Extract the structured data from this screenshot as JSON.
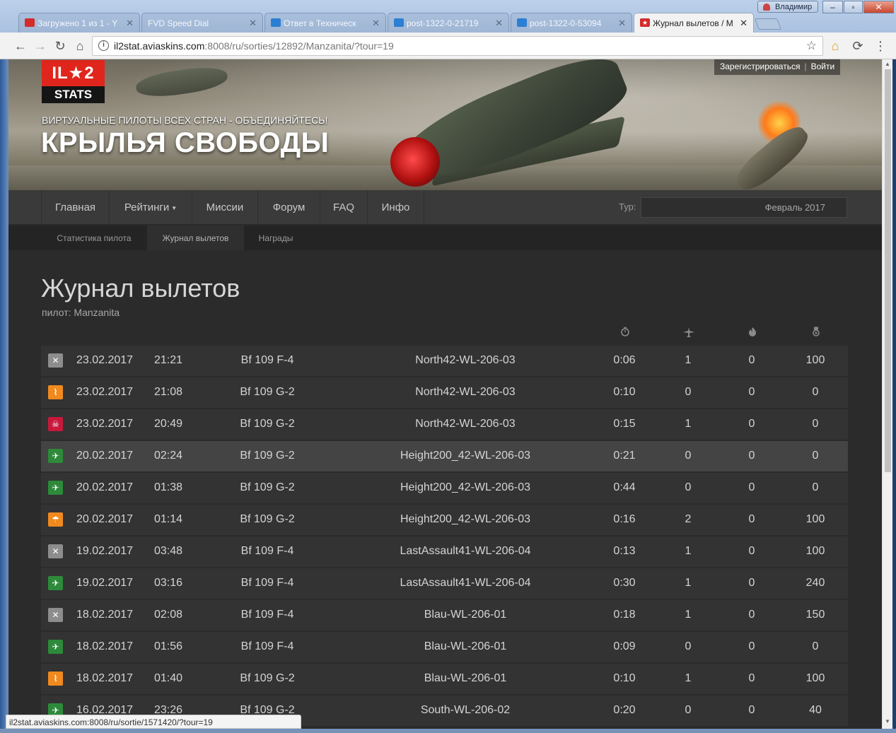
{
  "browser": {
    "tabs": [
      {
        "label": "Загружено 1 из 1 - Y",
        "favicon_color": "#d42b2b"
      },
      {
        "label": "FVD Speed Dial",
        "favicon_color": ""
      },
      {
        "label": "Ответ в Техническ",
        "favicon_color": "#2b7fd4"
      },
      {
        "label": "post-1322-0-21719",
        "favicon_color": "#2b7fd4"
      },
      {
        "label": "post-1322-0-53094",
        "favicon_color": "#2b7fd4"
      },
      {
        "label": "Журнал вылетов / M",
        "favicon_color": "#d42b2b"
      }
    ],
    "profile_name": "Владимир",
    "url_host": "il2stat.aviaskins.com",
    "url_path": ":8008/ru/sorties/12892/Manzanita/?tour=19",
    "status_url": "il2stat.aviaskins.com:8008/ru/sortie/1571420/?tour=19"
  },
  "header": {
    "logo_top": "IL★2",
    "logo_bottom": "STATS",
    "tagline": "ВИРТУАЛЬНЫЕ ПИЛОТЫ ВСЕХ СТРАН - ОБЪЕДИНЯЙТЕСЬ!",
    "title": "КРЫЛЬЯ СВОБОДЫ",
    "register": "Зарегистрироваться",
    "login": "Войти"
  },
  "nav": {
    "items": [
      "Главная",
      "Рейтинги",
      "Миссии",
      "Форум",
      "FAQ",
      "Инфо"
    ],
    "tour_label": "Тур:",
    "tour_value": "Февраль 2017"
  },
  "subnav": {
    "items": [
      "Статистика пилота",
      "Журнал вылетов",
      "Награды"
    ]
  },
  "page": {
    "title": "Журнал вылетов",
    "pilot_label": "пилот:",
    "pilot_name": "Manzanita"
  },
  "columns": {
    "duration_icon": "timer-icon",
    "kills_icon": "aircraft-icon",
    "ground_kills_icon": "fire-icon",
    "score_icon": "medal-icon"
  },
  "sorties": [
    {
      "status": "crashed",
      "color": "#8d8d8d",
      "date": "23.02.2017",
      "time": "21:21",
      "aircraft": "Bf 109 F-4",
      "mission": "North42-WL-206-03",
      "duration": "0:06",
      "kills": "1",
      "ground_kills": "0",
      "score": "100"
    },
    {
      "status": "ditched",
      "color": "#f08a1e",
      "date": "23.02.2017",
      "time": "21:08",
      "aircraft": "Bf 109 G-2",
      "mission": "North42-WL-206-03",
      "duration": "0:10",
      "kills": "0",
      "ground_kills": "0",
      "score": "0"
    },
    {
      "status": "killed",
      "color": "#c8183c",
      "date": "23.02.2017",
      "time": "20:49",
      "aircraft": "Bf 109 G-2",
      "mission": "North42-WL-206-03",
      "duration": "0:15",
      "kills": "1",
      "ground_kills": "0",
      "score": "0"
    },
    {
      "status": "landed",
      "color": "#2d8a3a",
      "date": "20.02.2017",
      "time": "02:24",
      "aircraft": "Bf 109 G-2",
      "mission": "Height200_42-WL-206-03",
      "duration": "0:21",
      "kills": "0",
      "ground_kills": "0",
      "score": "0"
    },
    {
      "status": "landed",
      "color": "#2d8a3a",
      "date": "20.02.2017",
      "time": "01:38",
      "aircraft": "Bf 109 G-2",
      "mission": "Height200_42-WL-206-03",
      "duration": "0:44",
      "kills": "0",
      "ground_kills": "0",
      "score": "0"
    },
    {
      "status": "bailed-out",
      "color": "#f08a1e",
      "date": "20.02.2017",
      "time": "01:14",
      "aircraft": "Bf 109 G-2",
      "mission": "Height200_42-WL-206-03",
      "duration": "0:16",
      "kills": "2",
      "ground_kills": "0",
      "score": "100"
    },
    {
      "status": "crashed",
      "color": "#8d8d8d",
      "date": "19.02.2017",
      "time": "03:48",
      "aircraft": "Bf 109 F-4",
      "mission": "LastAssault41-WL-206-04",
      "duration": "0:13",
      "kills": "1",
      "ground_kills": "0",
      "score": "100"
    },
    {
      "status": "landed",
      "color": "#2d8a3a",
      "date": "19.02.2017",
      "time": "03:16",
      "aircraft": "Bf 109 F-4",
      "mission": "LastAssault41-WL-206-04",
      "duration": "0:30",
      "kills": "1",
      "ground_kills": "0",
      "score": "240"
    },
    {
      "status": "crashed",
      "color": "#8d8d8d",
      "date": "18.02.2017",
      "time": "02:08",
      "aircraft": "Bf 109 F-4",
      "mission": "Blau-WL-206-01",
      "duration": "0:18",
      "kills": "1",
      "ground_kills": "0",
      "score": "150"
    },
    {
      "status": "landed",
      "color": "#2d8a3a",
      "date": "18.02.2017",
      "time": "01:56",
      "aircraft": "Bf 109 F-4",
      "mission": "Blau-WL-206-01",
      "duration": "0:09",
      "kills": "0",
      "ground_kills": "0",
      "score": "0"
    },
    {
      "status": "ditched",
      "color": "#f08a1e",
      "date": "18.02.2017",
      "time": "01:40",
      "aircraft": "Bf 109 G-2",
      "mission": "Blau-WL-206-01",
      "duration": "0:10",
      "kills": "1",
      "ground_kills": "0",
      "score": "100"
    },
    {
      "status": "landed",
      "color": "#2d8a3a",
      "date": "16.02.2017",
      "time": "23:26",
      "aircraft": "Bf 109 G-2",
      "mission": "South-WL-206-02",
      "duration": "0:20",
      "kills": "0",
      "ground_kills": "0",
      "score": "40"
    }
  ]
}
